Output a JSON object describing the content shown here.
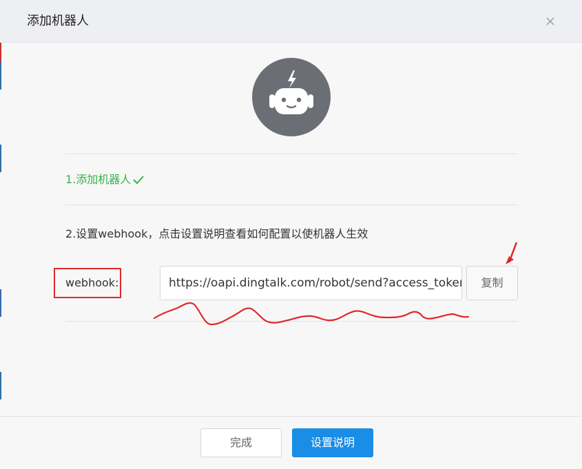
{
  "dialog": {
    "title": "添加机器人"
  },
  "steps": {
    "step1_label": "1.添加机器人",
    "step1_done_icon": "check-icon",
    "step2_label": "2.设置webhook，点击设置说明查看如何配置以使机器人生效"
  },
  "webhook": {
    "label": "webhook:",
    "value": "https://oapi.dingtalk.com/robot/send?access_token=",
    "copy_label": "复制"
  },
  "footer": {
    "done_label": "完成",
    "settings_label": "设置说明"
  },
  "colors": {
    "accent": "#1a8de6",
    "success": "#34b34a",
    "annotation": "#e0272b",
    "avatar_bg": "#6b6e74"
  }
}
